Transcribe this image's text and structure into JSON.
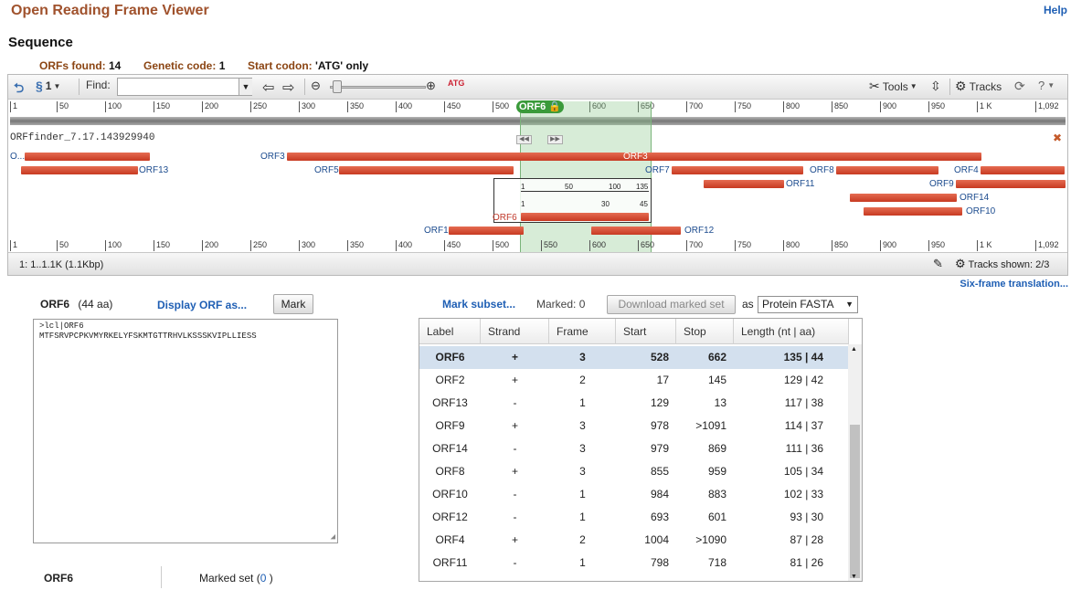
{
  "app": {
    "title": "Open Reading Frame Viewer",
    "help_label": "Help"
  },
  "section": {
    "title": "Sequence"
  },
  "summary": {
    "orfs_found_label": "ORFs found:",
    "orfs_found_value": "14",
    "genetic_code_label": "Genetic code:",
    "genetic_code_value": "1",
    "start_codon_label": "Start codon:",
    "start_codon_value": "'ATG' only"
  },
  "toolbar": {
    "strand_count": "1",
    "find_label": "Find:",
    "find_value": "",
    "tools_label": "Tools",
    "tracks_label": "Tracks"
  },
  "viewer": {
    "ruler_top": [
      "1",
      "50",
      "100",
      "150",
      "200",
      "250",
      "300",
      "350",
      "400",
      "450",
      "500",
      "550",
      "600",
      "650",
      "700",
      "750",
      "800",
      "850",
      "900",
      "950",
      "1 K",
      "1,092"
    ],
    "ruler_bottom": [
      "1",
      "50",
      "100",
      "150",
      "200",
      "250",
      "300",
      "350",
      "400",
      "450",
      "500",
      "550",
      "600",
      "650",
      "700",
      "750",
      "800",
      "850",
      "900",
      "950",
      "1 K",
      "1,092"
    ],
    "selected_tag": "ORF6",
    "track_name": "ORFfinder_7.17.143929940",
    "orf_labels": {
      "orf2": "O...",
      "orf13": "ORF13",
      "orf3": "ORF3",
      "orf3_inner": "ORF3",
      "orf5": "ORF5",
      "orf7": "ORF7",
      "orf8": "ORF8",
      "orf4": "ORF4",
      "orf11": "ORF11",
      "orf9": "ORF9",
      "orf14": "ORF14",
      "orf10": "ORF10",
      "orf6": "ORF6",
      "orf1": "ORF1",
      "orf12": "ORF12"
    },
    "zoom_nt_ticks": [
      "1",
      "50",
      "100",
      "135"
    ],
    "zoom_aa_ticks": [
      "1",
      "30",
      "45"
    ],
    "status_left": "1: 1..1.1K (1.1Kbp)",
    "tracks_shown": "Tracks shown: 2/3"
  },
  "six_frame_link": "Six-frame translation...",
  "orf_panel": {
    "name": "ORF6",
    "length": "(44 aa)",
    "display_link": "Display ORF as...",
    "mark_button": "Mark",
    "fasta_header": ">lcl|ORF6",
    "fasta_seq": "MTFSRVPCPKVMYRKELYFSKMTGTTRHVLKSSSKVIPLLIESS"
  },
  "table_controls": {
    "mark_subset": "Mark subset...",
    "marked_label": "Marked:",
    "marked_value": "0",
    "download_button": "Download marked set",
    "as_label": "as",
    "format_value": "Protein FASTA"
  },
  "table": {
    "columns": [
      "Label",
      "Strand",
      "Frame",
      "Start",
      "Stop",
      "Length (nt | aa)"
    ],
    "rows": [
      [
        "ORF6",
        "+",
        "3",
        "528",
        "662",
        "135 | 44"
      ],
      [
        "ORF2",
        "+",
        "2",
        "17",
        "145",
        "129 | 42"
      ],
      [
        "ORF13",
        "-",
        "1",
        "129",
        "13",
        "117 | 38"
      ],
      [
        "ORF9",
        "+",
        "3",
        "978",
        ">1091",
        "114 | 37"
      ],
      [
        "ORF14",
        "-",
        "3",
        "979",
        "869",
        "111 | 36"
      ],
      [
        "ORF8",
        "+",
        "3",
        "855",
        "959",
        "105 | 34"
      ],
      [
        "ORF10",
        "-",
        "1",
        "984",
        "883",
        "102 | 33"
      ],
      [
        "ORF12",
        "-",
        "1",
        "693",
        "601",
        "93 | 30"
      ],
      [
        "ORF4",
        "+",
        "2",
        "1004",
        ">1090",
        "87 | 28"
      ],
      [
        "ORF11",
        "-",
        "1",
        "798",
        "718",
        "81 | 26"
      ]
    ]
  },
  "bottom": {
    "orf_tab": "ORF6",
    "marked_set_label": "Marked set (",
    "marked_set_count": "0",
    "marked_set_close": ")"
  }
}
